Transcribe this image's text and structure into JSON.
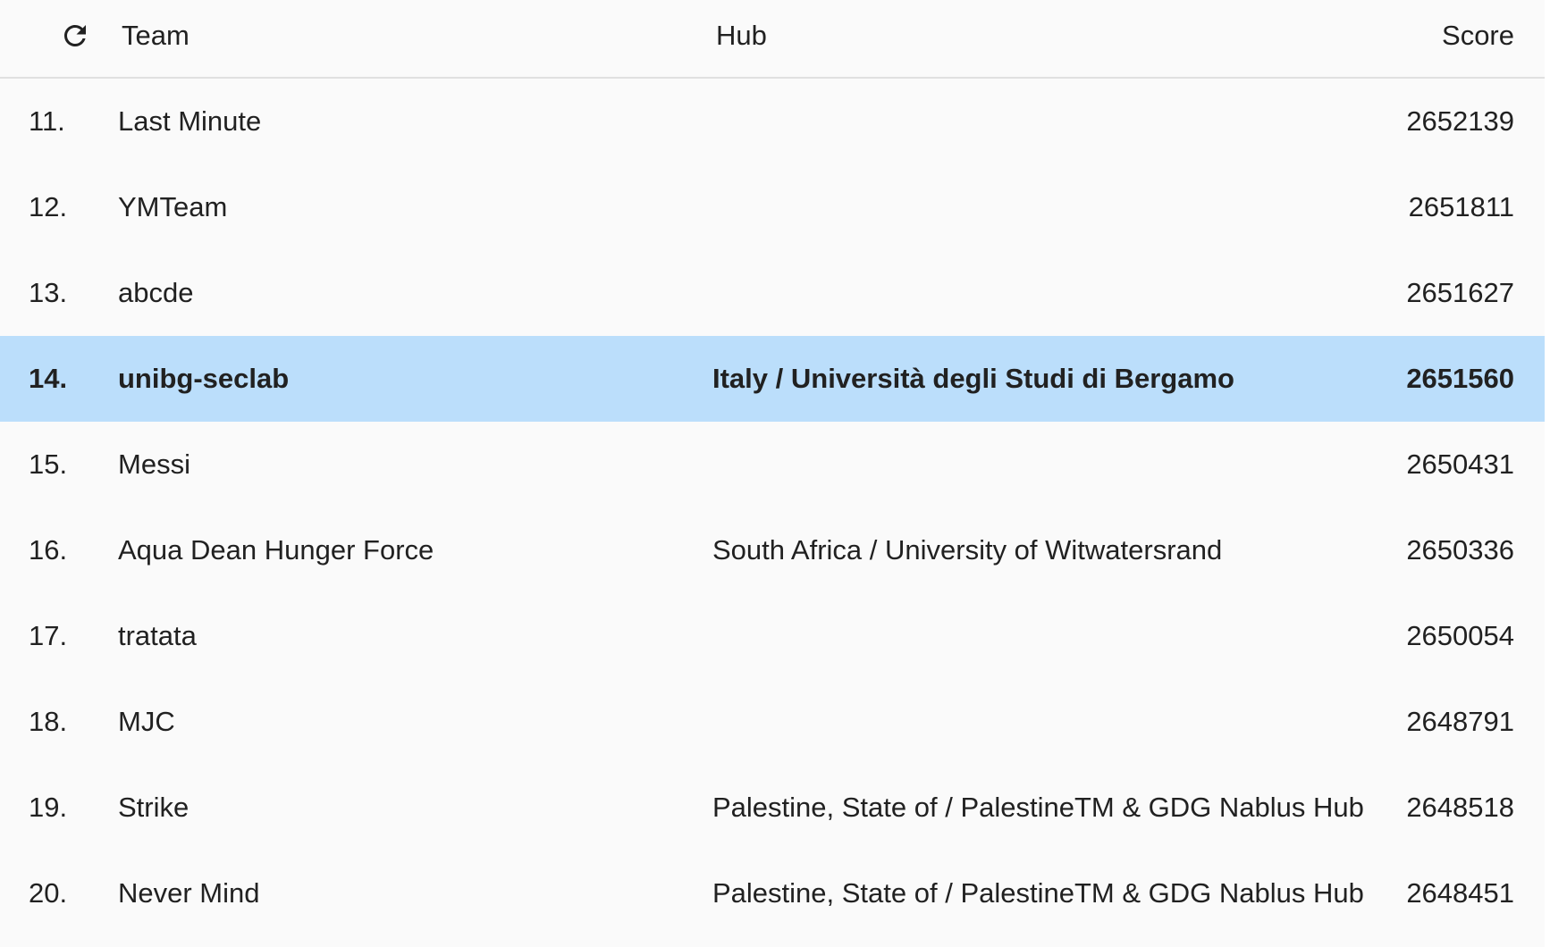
{
  "colors": {
    "background": "#fafafa",
    "highlight_row": "#bbdefb",
    "header_border": "#e0e0e0",
    "text": "#212121"
  },
  "header": {
    "refresh_icon": "refresh-icon",
    "team": "Team",
    "hub": "Hub",
    "score": "Score"
  },
  "rows": [
    {
      "rank": "11.",
      "team": "Last Minute",
      "hub": "",
      "score": "2652139",
      "highlighted": false
    },
    {
      "rank": "12.",
      "team": "YMTeam",
      "hub": "",
      "score": "2651811",
      "highlighted": false
    },
    {
      "rank": "13.",
      "team": "abcde",
      "hub": "",
      "score": "2651627",
      "highlighted": false
    },
    {
      "rank": "14.",
      "team": "unibg-seclab",
      "hub": "Italy / Università degli Studi di Bergamo",
      "score": "2651560",
      "highlighted": true
    },
    {
      "rank": "15.",
      "team": "Messi",
      "hub": "",
      "score": "2650431",
      "highlighted": false
    },
    {
      "rank": "16.",
      "team": "Aqua Dean Hunger Force",
      "hub": "South Africa / University of Witwatersrand",
      "score": "2650336",
      "highlighted": false
    },
    {
      "rank": "17.",
      "team": "tratata",
      "hub": "",
      "score": "2650054",
      "highlighted": false
    },
    {
      "rank": "18.",
      "team": "MJC",
      "hub": "",
      "score": "2648791",
      "highlighted": false
    },
    {
      "rank": "19.",
      "team": "Strike",
      "hub": "Palestine, State of / PalestineTM & GDG Nablus Hub",
      "score": "2648518",
      "highlighted": false
    },
    {
      "rank": "20.",
      "team": "Never Mind",
      "hub": "Palestine, State of / PalestineTM & GDG Nablus Hub",
      "score": "2648451",
      "highlighted": false
    }
  ]
}
